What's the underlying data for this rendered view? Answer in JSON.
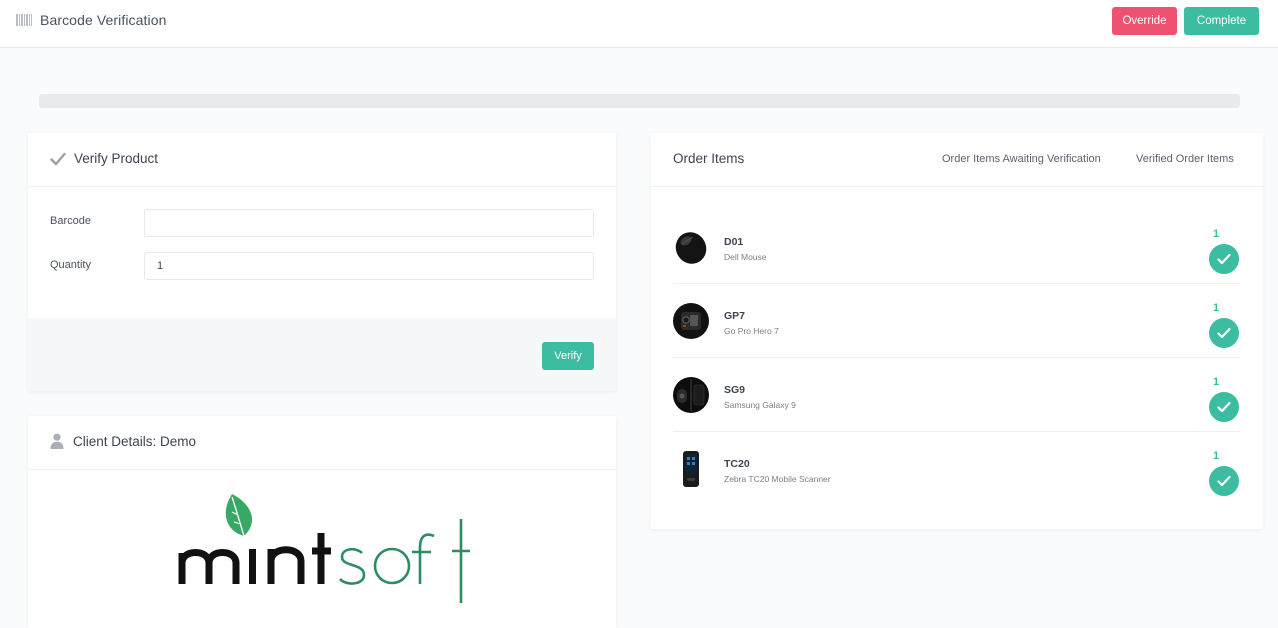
{
  "header": {
    "title": "Barcode Verification",
    "override_label": "Override",
    "complete_label": "Complete"
  },
  "progress": {
    "value": 0
  },
  "verify": {
    "title": "Verify Product",
    "barcode_label": "Barcode",
    "barcode_value": "",
    "quantity_label": "Quantity",
    "quantity_value": "1",
    "verify_label": "Verify"
  },
  "client": {
    "title": "Client Details: Demo",
    "logo_text": "mintsoft"
  },
  "orders": {
    "title": "Order Items",
    "tab_awaiting": "Order Items Awaiting Verification",
    "tab_verified": "Verified Order Items",
    "items": [
      {
        "sku": "D01",
        "name": "Dell Mouse",
        "qty": "1",
        "image_icon": "mouse-icon"
      },
      {
        "sku": "GP7",
        "name": "Go Pro Hero 7",
        "qty": "1",
        "image_icon": "gopro-icon"
      },
      {
        "sku": "SG9",
        "name": "Samsung Galaxy 9",
        "qty": "1",
        "image_icon": "phone-icon"
      },
      {
        "sku": "TC20",
        "name": "Zebra TC20 Mobile Scanner",
        "qty": "1",
        "image_icon": "scanner-icon"
      }
    ]
  },
  "colors": {
    "accent": "#3cbca0",
    "danger": "#ef5170",
    "progress_track": "#e8ebee"
  }
}
